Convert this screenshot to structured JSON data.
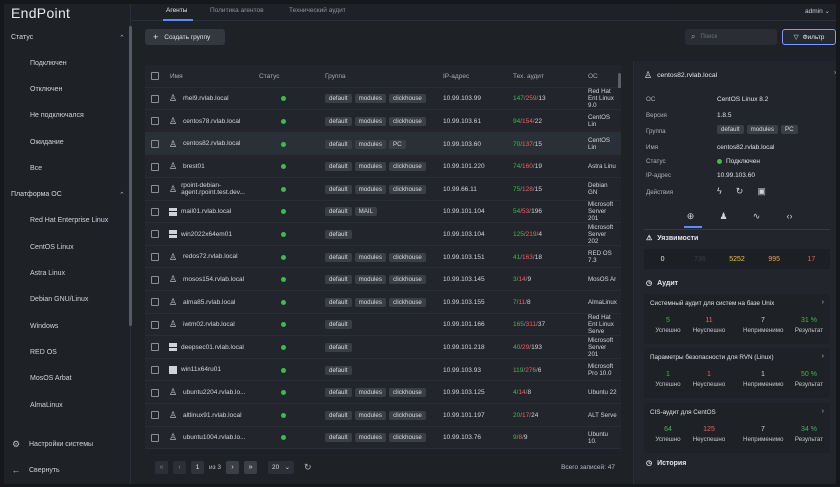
{
  "app": {
    "logo": "EndPoint"
  },
  "sidebar": {
    "status_section": "Статус",
    "status_items": [
      "Подключен",
      "Отключен",
      "Не подключался",
      "Ожидание",
      "Все"
    ],
    "os_section": "Платформа ОС",
    "os_items": [
      "Red Hat Enterprise Linux",
      "CentOS Linux",
      "Astra Linux",
      "Debian GNU/Linux",
      "Windows",
      "RED OS",
      "MosOS Arbat",
      "AlmaLinux"
    ],
    "settings": "Настройки системы",
    "collapse": "Свернуть"
  },
  "header": {
    "tabs": [
      "Агенты",
      "Политика агентов",
      "Технический аудит"
    ],
    "user": "admin"
  },
  "toolbar": {
    "create": "Создать группу",
    "search_placeholder": "Поиск",
    "filter": "Фильтр"
  },
  "table": {
    "columns": [
      "Имя",
      "Статус",
      "Группа",
      "IP-адрес",
      "Тех. аудит",
      "ОС"
    ],
    "rows": [
      {
        "name": "rhel9.rvlab.local",
        "os_icon": "linux",
        "groups": [
          "default",
          "modules",
          "clickhouse"
        ],
        "ip": "10.99.103.99",
        "a1": "147",
        "a2": "259",
        "a3": "13",
        "os": "Red Hat Ent Linux 9.0"
      },
      {
        "name": "centos78.rvlab.local",
        "os_icon": "linux",
        "groups": [
          "default",
          "modules",
          "clickhouse"
        ],
        "ip": "10.99.103.61",
        "a1": "94",
        "a2": "154",
        "a3": "22",
        "os": "CentOS Lin"
      },
      {
        "name": "centos82.rvlab.local",
        "os_icon": "linux",
        "groups": [
          "default",
          "modules",
          "PC"
        ],
        "ip": "10.99.103.60",
        "a1": "70",
        "a2": "137",
        "a3": "15",
        "os": "CentOS Lin",
        "selected": true
      },
      {
        "name": "brest01",
        "os_icon": "linux",
        "groups": [
          "default",
          "modules",
          "clickhouse"
        ],
        "ip": "10.99.101.220",
        "a1": "74",
        "a2": "160",
        "a3": "19",
        "os": "Astra Linu"
      },
      {
        "name": "rpoint-debian-agent.rpoint.test.dev...",
        "os_icon": "linux",
        "groups": [
          "default",
          "modules",
          "clickhouse"
        ],
        "ip": "10.99.66.11",
        "a1": "75",
        "a2": "128",
        "a3": "15",
        "os": "Debian GN"
      },
      {
        "name": "mail01.rvlab.local",
        "os_icon": "windows",
        "groups": [
          "default",
          "MAIL"
        ],
        "ip": "10.99.101.104",
        "a1": "54",
        "a2": "53",
        "a3": "196",
        "os": "Microsoft Server 201"
      },
      {
        "name": "win2022x64em01",
        "os_icon": "windows",
        "groups": [
          "default"
        ],
        "ip": "10.99.103.104",
        "a1": "125",
        "a2": "219",
        "a3": "4",
        "os": "Microsoft Server 202"
      },
      {
        "name": "redos72.rvlab.local",
        "os_icon": "linux",
        "groups": [
          "default",
          "modules",
          "clickhouse"
        ],
        "ip": "10.99.103.151",
        "a1": "41",
        "a2": "163",
        "a3": "18",
        "os": "RED OS 7.3"
      },
      {
        "name": "mosos154.rvlab.local",
        "os_icon": "linux",
        "groups": [
          "default",
          "modules",
          "clickhouse"
        ],
        "ip": "10.99.103.145",
        "a1": "3",
        "a2": "14",
        "a3": "9",
        "os": "MosOS Ar"
      },
      {
        "name": "alma85.rvlab.local",
        "os_icon": "linux",
        "groups": [
          "default",
          "modules",
          "clickhouse"
        ],
        "ip": "10.99.103.155",
        "a1": "7",
        "a2": "11",
        "a3": "8",
        "os": "AlmaLinux"
      },
      {
        "name": "iwtm02.rvlab.local",
        "os_icon": "linux",
        "groups": [
          "default"
        ],
        "ip": "10.99.101.166",
        "a1": "165",
        "a2": "311",
        "a3": "37",
        "os": "Red Hat Ent Linux Serve"
      },
      {
        "name": "deepsec01.rvlab.local",
        "os_icon": "windows",
        "groups": [
          "default"
        ],
        "ip": "10.99.101.218",
        "a1": "40",
        "a2": "29",
        "a3": "193",
        "os": "Microsoft Server 201"
      },
      {
        "name": "win11x64ru01",
        "os_icon": "windows",
        "groups": [
          "default"
        ],
        "ip": "10.99.103.93",
        "a1": "119",
        "a2": "276",
        "a3": "6",
        "os": "Microsoft Pro 10.0"
      },
      {
        "name": "ubuntu2204.rvlab.lo...",
        "os_icon": "linux",
        "groups": [
          "default",
          "modules",
          "clickhouse"
        ],
        "ip": "10.99.103.125",
        "a1": "4",
        "a2": "14",
        "a3": "8",
        "os": "Ubuntu 22"
      },
      {
        "name": "altlinux91.rvlab.local",
        "os_icon": "linux",
        "groups": [
          "default",
          "modules",
          "clickhouse"
        ],
        "ip": "10.99.101.197",
        "a1": "20",
        "a2": "17",
        "a3": "24",
        "os": "ALT Serve"
      },
      {
        "name": "ubuntu1004.rvlab.lo...",
        "os_icon": "linux",
        "groups": [
          "default",
          "modules",
          "clickhouse"
        ],
        "ip": "10.99.103.76",
        "a1": "9",
        "a2": "8",
        "a3": "9",
        "os": "Ubuntu 10."
      }
    ]
  },
  "pager": {
    "page": "1",
    "of": "из 3",
    "size": "20",
    "total": "Всего записей: 47"
  },
  "detail": {
    "title": "centos82.rvlab.local",
    "fields": [
      {
        "label": "ОС",
        "value": "CentOS Linux 8.2"
      },
      {
        "label": "Версия",
        "value": "1.8.5"
      },
      {
        "label": "Группа",
        "value": ""
      },
      {
        "label": "Имя",
        "value": "centos82.rvlab.local"
      },
      {
        "label": "Статус",
        "value": "Подключен"
      },
      {
        "label": "IP-адрес",
        "value": "10.99.103.60"
      },
      {
        "label": "Действия",
        "value": ""
      }
    ],
    "groups": [
      "default",
      "modules",
      "PC"
    ],
    "vuln_title": "Уязвимости",
    "vuln_values": [
      "0",
      "736",
      "5252",
      "995",
      "17"
    ],
    "audit_title": "Аудит",
    "audit_labels": [
      "Успешно",
      "Неуспешно",
      "Неприменимо",
      "Результат"
    ],
    "audits": [
      {
        "title": "Системный аудит для систем на базе Unix",
        "values": [
          "5",
          "11",
          "7",
          "31 %"
        ]
      },
      {
        "title": "Параметры безопасности для RVN (Linux)",
        "values": [
          "1",
          "1",
          "1",
          "50 %"
        ]
      },
      {
        "title": "CIS-аудит для CentOS",
        "values": [
          "64",
          "125",
          "7",
          "34 %"
        ]
      }
    ],
    "history_title": "История"
  },
  "colors": {
    "accent": "#5b8cff",
    "success": "#3fb950",
    "danger": "#f0605c",
    "warning": "#f0a24b"
  }
}
